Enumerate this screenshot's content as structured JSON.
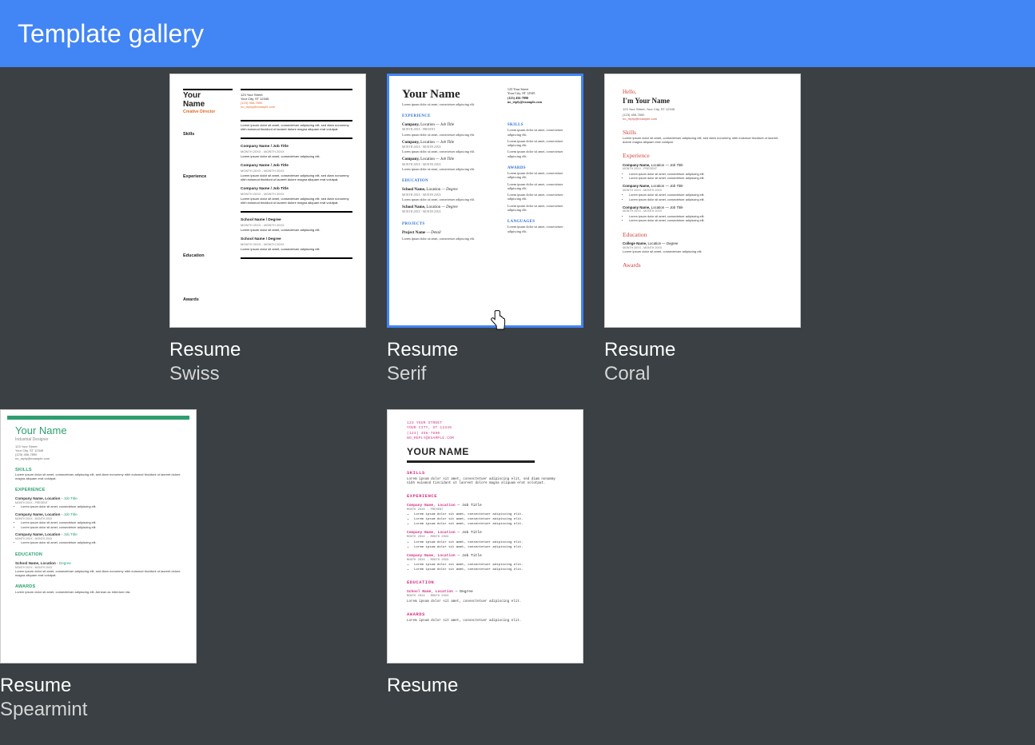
{
  "header": {
    "title": "Template gallery"
  },
  "cards": [
    {
      "title": "Resume",
      "subtitle": "Swiss"
    },
    {
      "title": "Resume",
      "subtitle": "Serif",
      "selected": true
    },
    {
      "title": "Resume",
      "subtitle": "Coral"
    },
    {
      "title": "Resume",
      "subtitle": "Spearmint"
    },
    {
      "title": "Resume",
      "subtitle": ""
    }
  ],
  "common": {
    "lorem_short": "Lorem ipsum dolor sit amet, consectetuer adipiscing elit.",
    "lorem_long": "Lorem ipsum dolor sit amet, consectetuer adipiscing elit, sed diam nonummy nibh euismod tincidunt ut laoreet dolore magna aliquam erat volutpat.",
    "address1": "123 Your Street",
    "address2": "Your City, ST 12345",
    "phone": "(123) 456-7890",
    "email": "no_reply@example.com",
    "company_line": "Company Name, Location — Job Title",
    "company_line2": "Company Name / Job Title",
    "school_line": "School Name, Location — Degree",
    "school_line2": "School Name / Degree",
    "date_range": "MONTH 20XX - MONTH 20XX",
    "date_present": "MONTH 20XX - PRESENT"
  },
  "swiss": {
    "name1": "Your",
    "name2": "Name",
    "role": "Creative Director",
    "sections_left": [
      "Skills",
      "Experience",
      "Education",
      "Awards"
    ],
    "span_jt": "Job Title",
    "span_cn": "Company Name"
  },
  "serif": {
    "name": "Your Name",
    "s_exp": "EXPERIENCE",
    "s_edu": "EDUCATION",
    "s_proj": "PROJECTS",
    "s_skills": "SKILLS",
    "s_awards": "AWARDS",
    "s_lang": "LANGUAGES",
    "proj_line": "Project Name — Detail"
  },
  "coral": {
    "hello": "Hello,",
    "im": "I'm Your Name",
    "s_skills": "Skills",
    "s_exp": "Experience",
    "s_edu": "Education",
    "s_awards": "Awards",
    "college_line": "College Name, Location — Degree"
  },
  "spearmint": {
    "name": "Your Name",
    "role": "Industrial Designer",
    "s_skills": "SKILLS",
    "s_exp": "EXPERIENCE",
    "s_edu": "EDUCATION",
    "s_awards": "AWARDS",
    "award_tail": "Aenean ac interdum nisi."
  },
  "modern": {
    "addr1": "123 YOUR STREET",
    "addr2": "YOUR CITY, ST 12345",
    "addr3": "(123) 456-7890",
    "addr4": "NO_REPLY@EXAMPLE.COM",
    "name": "YOUR NAME",
    "s_skills": "SKILLS",
    "s_exp": "EXPERIENCE",
    "s_edu": "EDUCATION",
    "s_awards": "AWARDS",
    "jt": "Job Title",
    "deg": "Degree",
    "cn": "Company Name, Location",
    "sn": "School Name, Location"
  }
}
